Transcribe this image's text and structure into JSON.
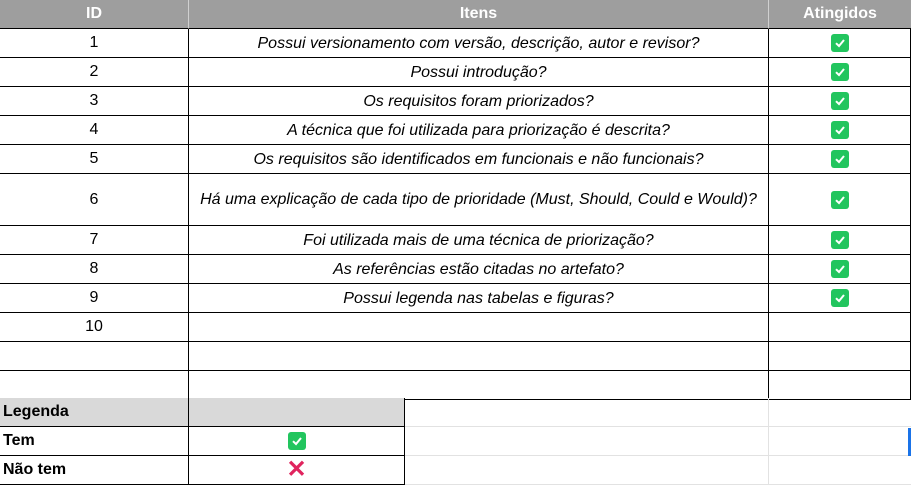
{
  "header": {
    "id": "ID",
    "items": "Itens",
    "achieved": "Atingidos"
  },
  "rows": [
    {
      "id": "1",
      "text": "Possui versionamento com versão, descrição, autor e revisor?",
      "checked": true
    },
    {
      "id": "2",
      "text": "Possui introdução?",
      "checked": true
    },
    {
      "id": "3",
      "text": "Os requisitos foram priorizados?",
      "checked": true
    },
    {
      "id": "4",
      "text": "A técnica que foi utilizada para priorização é descrita?",
      "checked": true
    },
    {
      "id": "5",
      "text": "Os requisitos são identificados em funcionais e não funcionais?",
      "checked": true
    },
    {
      "id": "6",
      "text": "Há uma explicação de cada tipo de prioridade (Must, Should, Could e Would)?",
      "checked": true
    },
    {
      "id": "7",
      "text": "Foi utilizada mais de uma técnica de priorização?",
      "checked": true
    },
    {
      "id": "8",
      "text": "As referências estão citadas no artefato?",
      "checked": true
    },
    {
      "id": "9",
      "text": "Possui legenda nas tabelas e figuras?",
      "checked": true
    },
    {
      "id": "10",
      "text": "",
      "checked": false
    },
    {
      "id": "",
      "text": "",
      "checked": false
    },
    {
      "id": "",
      "text": "",
      "checked": false
    }
  ],
  "legend": {
    "title": "Legenda",
    "has_label": "Tem",
    "has_not_label": "Não tem",
    "has_icon": "check-icon",
    "has_not_icon": "cross-icon",
    "cross_glyph": "✕"
  },
  "colors": {
    "header_bg": "#9e9e9e",
    "check": "#22c55e",
    "cross": "#e0245e",
    "legend_bg": "#d9d9d9"
  }
}
